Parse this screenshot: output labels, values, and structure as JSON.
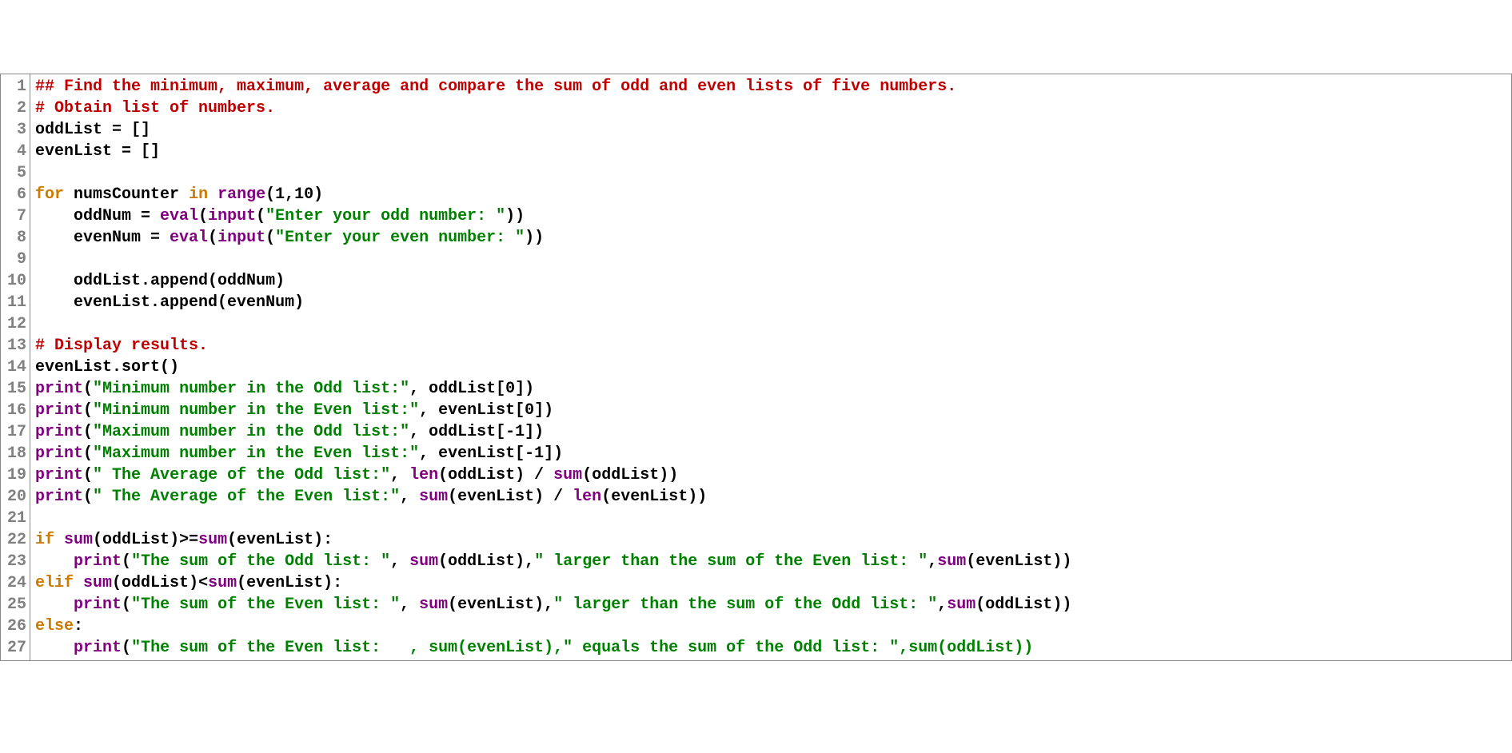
{
  "lines": [
    {
      "num": "1",
      "tokens": [
        [
          "comment",
          "## Find the minimum, maximum, average and compare the sum of odd and even lists of five numbers."
        ]
      ]
    },
    {
      "num": "2",
      "tokens": [
        [
          "comment",
          "# Obtain list of numbers."
        ]
      ]
    },
    {
      "num": "3",
      "tokens": [
        [
          "txt",
          "oddList = []"
        ]
      ]
    },
    {
      "num": "4",
      "tokens": [
        [
          "txt",
          "evenList = []"
        ]
      ]
    },
    {
      "num": "5",
      "tokens": []
    },
    {
      "num": "6",
      "tokens": [
        [
          "kw",
          "for "
        ],
        [
          "txt",
          "numsCounter "
        ],
        [
          "kw",
          "in "
        ],
        [
          "builtin",
          "range"
        ],
        [
          "txt",
          "(1,10)"
        ]
      ]
    },
    {
      "num": "7",
      "tokens": [
        [
          "txt",
          "    oddNum = "
        ],
        [
          "builtin",
          "eval"
        ],
        [
          "txt",
          "("
        ],
        [
          "builtin",
          "input"
        ],
        [
          "txt",
          "("
        ],
        [
          "str",
          "\"Enter your odd number: \""
        ],
        [
          "txt",
          "))"
        ]
      ]
    },
    {
      "num": "8",
      "tokens": [
        [
          "txt",
          "    evenNum = "
        ],
        [
          "builtin",
          "eval"
        ],
        [
          "txt",
          "("
        ],
        [
          "builtin",
          "input"
        ],
        [
          "txt",
          "("
        ],
        [
          "str",
          "\"Enter your even number: \""
        ],
        [
          "txt",
          "))"
        ]
      ]
    },
    {
      "num": "9",
      "tokens": []
    },
    {
      "num": "10",
      "tokens": [
        [
          "txt",
          "    oddList.append(oddNum)"
        ]
      ]
    },
    {
      "num": "11",
      "tokens": [
        [
          "txt",
          "    evenList.append(evenNum)"
        ]
      ]
    },
    {
      "num": "12",
      "tokens": []
    },
    {
      "num": "13",
      "tokens": [
        [
          "comment",
          "# Display results."
        ]
      ]
    },
    {
      "num": "14",
      "tokens": [
        [
          "txt",
          "evenList.sort()"
        ]
      ]
    },
    {
      "num": "15",
      "tokens": [
        [
          "builtin",
          "print"
        ],
        [
          "txt",
          "("
        ],
        [
          "str",
          "\"Minimum number in the Odd list:\""
        ],
        [
          "txt",
          ", oddList[0])"
        ]
      ]
    },
    {
      "num": "16",
      "tokens": [
        [
          "builtin",
          "print"
        ],
        [
          "txt",
          "("
        ],
        [
          "str",
          "\"Minimum number in the Even list:\""
        ],
        [
          "txt",
          ", evenList[0])"
        ]
      ]
    },
    {
      "num": "17",
      "tokens": [
        [
          "builtin",
          "print"
        ],
        [
          "txt",
          "("
        ],
        [
          "str",
          "\"Maximum number in the Odd list:\""
        ],
        [
          "txt",
          ", oddList[-1])"
        ]
      ]
    },
    {
      "num": "18",
      "tokens": [
        [
          "builtin",
          "print"
        ],
        [
          "txt",
          "("
        ],
        [
          "str",
          "\"Maximum number in the Even list:\""
        ],
        [
          "txt",
          ", evenList[-1])"
        ]
      ]
    },
    {
      "num": "19",
      "tokens": [
        [
          "builtin",
          "print"
        ],
        [
          "txt",
          "("
        ],
        [
          "str",
          "\" The Average of the Odd list:\""
        ],
        [
          "txt",
          ", "
        ],
        [
          "builtin",
          "len"
        ],
        [
          "txt",
          "(oddList) / "
        ],
        [
          "builtin",
          "sum"
        ],
        [
          "txt",
          "(oddList))"
        ]
      ]
    },
    {
      "num": "20",
      "tokens": [
        [
          "builtin",
          "print"
        ],
        [
          "txt",
          "("
        ],
        [
          "str",
          "\" The Average of the Even list:\""
        ],
        [
          "txt",
          ", "
        ],
        [
          "builtin",
          "sum"
        ],
        [
          "txt",
          "(evenList) / "
        ],
        [
          "builtin",
          "len"
        ],
        [
          "txt",
          "(evenList))"
        ]
      ]
    },
    {
      "num": "21",
      "tokens": []
    },
    {
      "num": "22",
      "tokens": [
        [
          "kw",
          "if "
        ],
        [
          "builtin",
          "sum"
        ],
        [
          "txt",
          "(oddList)>="
        ],
        [
          "builtin",
          "sum"
        ],
        [
          "txt",
          "(evenList):"
        ]
      ]
    },
    {
      "num": "23",
      "tokens": [
        [
          "txt",
          "    "
        ],
        [
          "builtin",
          "print"
        ],
        [
          "txt",
          "("
        ],
        [
          "str",
          "\"The sum of the Odd list: \""
        ],
        [
          "txt",
          ", "
        ],
        [
          "builtin",
          "sum"
        ],
        [
          "txt",
          "(oddList),"
        ],
        [
          "str",
          "\" larger than the sum of the Even list: \""
        ],
        [
          "txt",
          ","
        ],
        [
          "builtin",
          "sum"
        ],
        [
          "txt",
          "(evenList))"
        ]
      ]
    },
    {
      "num": "24",
      "tokens": [
        [
          "kw",
          "elif "
        ],
        [
          "builtin",
          "sum"
        ],
        [
          "txt",
          "(oddList)<"
        ],
        [
          "builtin",
          "sum"
        ],
        [
          "txt",
          "(evenList):"
        ]
      ]
    },
    {
      "num": "25",
      "tokens": [
        [
          "txt",
          "    "
        ],
        [
          "builtin",
          "print"
        ],
        [
          "txt",
          "("
        ],
        [
          "str",
          "\"The sum of the Even list: \""
        ],
        [
          "txt",
          ", "
        ],
        [
          "builtin",
          "sum"
        ],
        [
          "txt",
          "(evenList),"
        ],
        [
          "str",
          "\" larger than the sum of the Odd list: \""
        ],
        [
          "txt",
          ","
        ],
        [
          "builtin",
          "sum"
        ],
        [
          "txt",
          "(oddList))"
        ]
      ]
    },
    {
      "num": "26",
      "tokens": [
        [
          "kw",
          "else"
        ],
        [
          "txt",
          ":"
        ]
      ]
    },
    {
      "num": "27",
      "tokens": [
        [
          "txt",
          "    "
        ],
        [
          "builtin",
          "print"
        ],
        [
          "txt",
          "("
        ],
        [
          "str",
          "\"The sum of the Even list:   , sum(evenList),\""
        ],
        [
          "str",
          " equals the sum of the Odd list: "
        ],
        [
          "str",
          "\",sum(oddList))"
        ]
      ]
    }
  ],
  "line27_override": [
    [
      "txt",
      "    "
    ],
    [
      "builtin",
      "print"
    ],
    [
      "txt",
      "("
    ],
    [
      "str",
      "\"The sum of the Even list:   , sum(evenList),\" equals the sum of the Odd list: \",sum(oddList))"
    ]
  ]
}
